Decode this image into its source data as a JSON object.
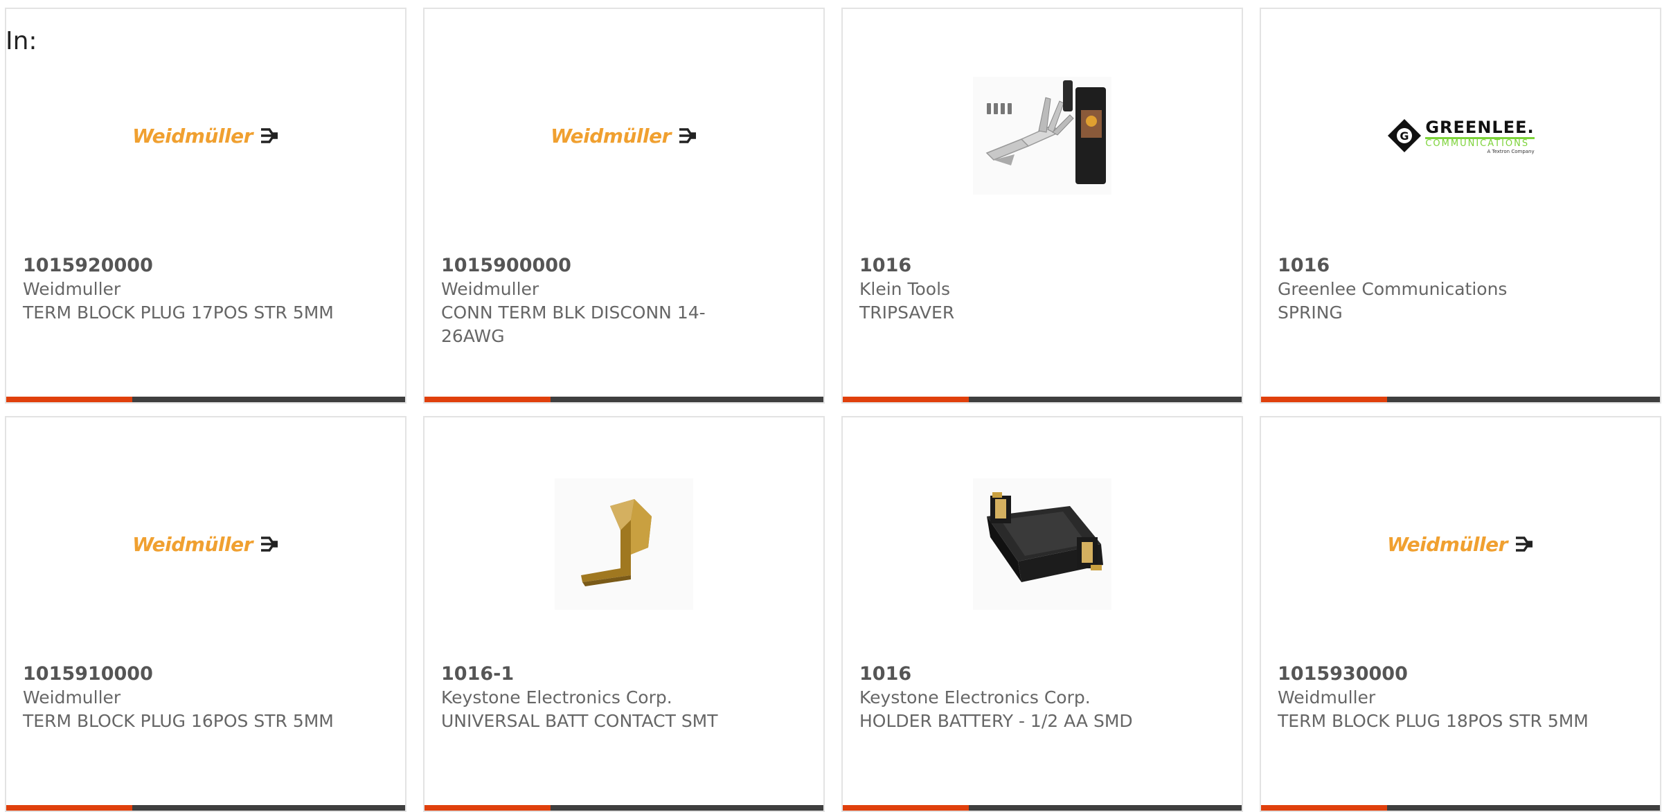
{
  "page": {
    "label": "In:"
  },
  "colors": {
    "accent": "#e0400c",
    "bar": "#3f3f3f",
    "weidmuller_orange": "#f0a030",
    "greenlee_green": "#7dd33a"
  },
  "products": [
    {
      "part_number": "1015920000",
      "manufacturer": "Weidmuller",
      "description": "TERM BLOCK PLUG 17POS STR 5MM",
      "image": "weidmuller-logo",
      "logo_text": "Weidmüller"
    },
    {
      "part_number": "1015900000",
      "manufacturer": "Weidmuller",
      "description": "CONN TERM BLK DISCONN 14-26AWG",
      "image": "weidmuller-logo",
      "logo_text": "Weidmüller"
    },
    {
      "part_number": "1016",
      "manufacturer": "Klein Tools",
      "description": "TRIPSAVER",
      "image": "multitool-photo"
    },
    {
      "part_number": "1016",
      "manufacturer": "Greenlee Communications",
      "description": "SPRING",
      "image": "greenlee-logo",
      "logo_text": "GREENLEE.",
      "logo_subtext": "COMMUNICATIONS",
      "logo_tagline": "A Textron Company"
    },
    {
      "part_number": "1015910000",
      "manufacturer": "Weidmuller",
      "description": "TERM BLOCK PLUG 16POS STR 5MM",
      "image": "weidmuller-logo",
      "logo_text": "Weidmüller"
    },
    {
      "part_number": "1016-1",
      "manufacturer": "Keystone Electronics Corp.",
      "description": "UNIVERSAL BATT CONTACT SMT",
      "image": "battery-contact-photo"
    },
    {
      "part_number": "1016",
      "manufacturer": "Keystone Electronics Corp.",
      "description": "HOLDER BATTERY - 1/2 AA SMD",
      "image": "battery-holder-photo"
    },
    {
      "part_number": "1015930000",
      "manufacturer": "Weidmuller",
      "description": "TERM BLOCK PLUG 18POS STR 5MM",
      "image": "weidmuller-logo",
      "logo_text": "Weidmüller"
    }
  ]
}
